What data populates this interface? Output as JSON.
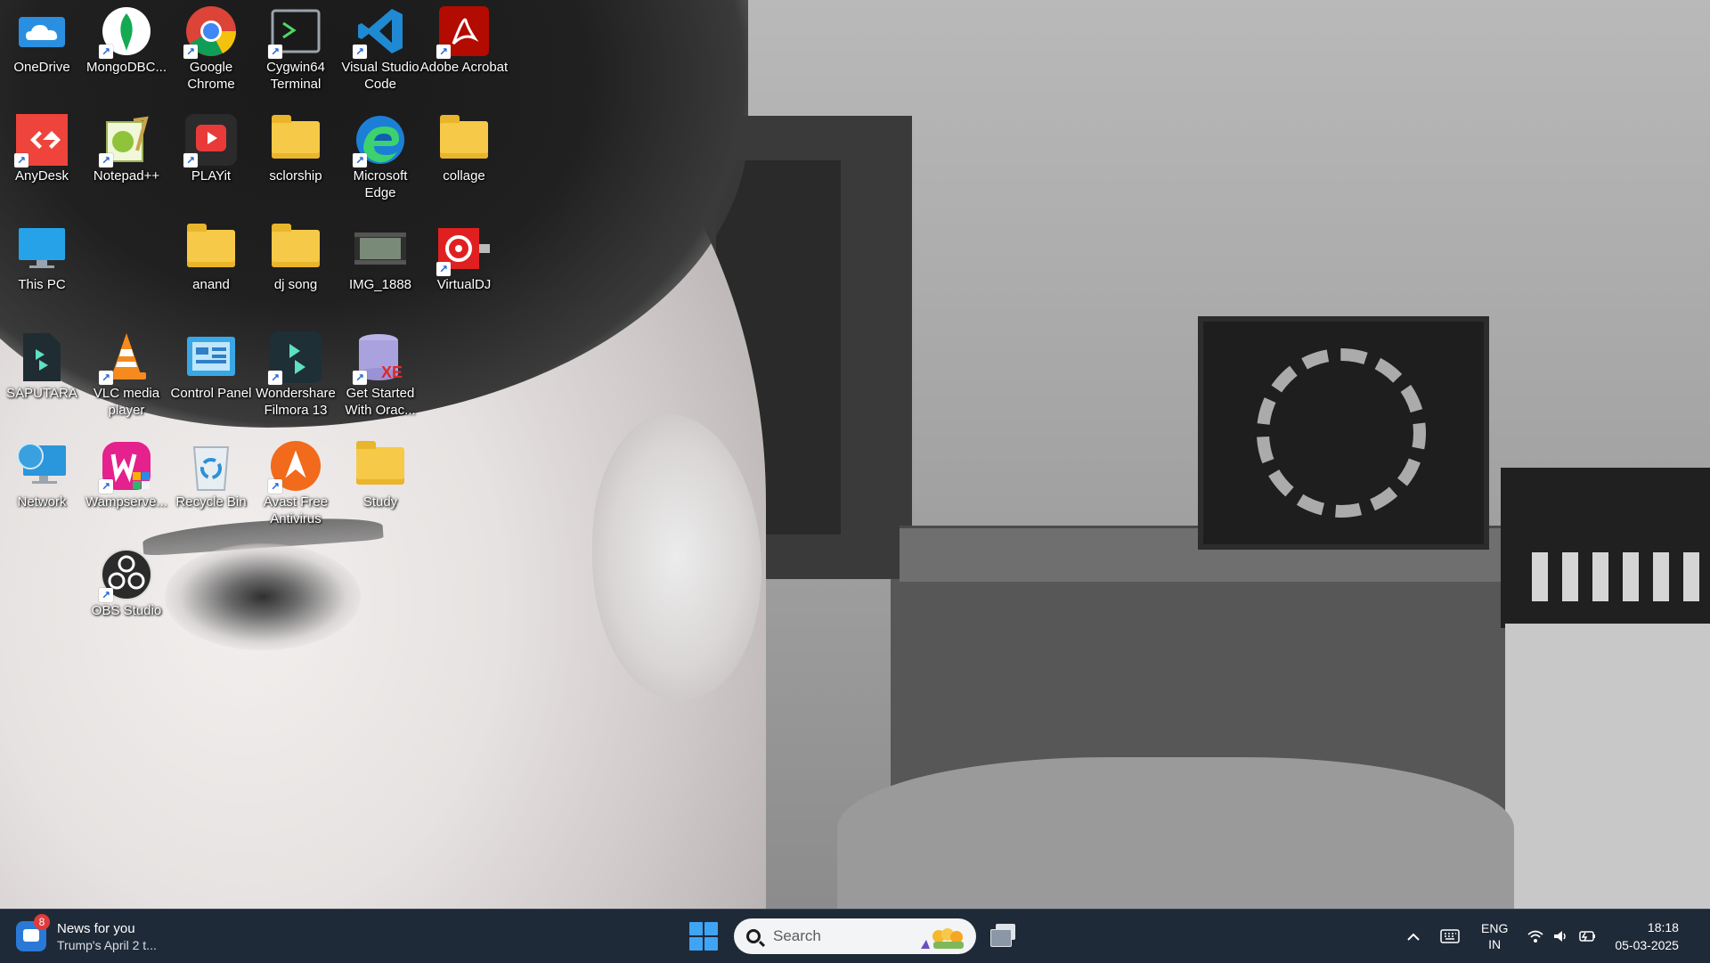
{
  "desktop": {
    "icons": [
      {
        "label": "OneDrive"
      },
      {
        "label": "MongoDBC..."
      },
      {
        "label": "Google Chrome"
      },
      {
        "label": "Cygwin64 Terminal"
      },
      {
        "label": "Visual Studio Code"
      },
      {
        "label": "Adobe Acrobat"
      },
      {
        "label": "AnyDesk"
      },
      {
        "label": "Notepad++"
      },
      {
        "label": "PLAYit"
      },
      {
        "label": "sclorship"
      },
      {
        "label": "Microsoft Edge"
      },
      {
        "label": "collage"
      },
      {
        "label": "This PC"
      },
      {
        "label": "anand"
      },
      {
        "label": "dj song"
      },
      {
        "label": "IMG_1888"
      },
      {
        "label": "VirtualDJ"
      },
      {
        "label": "SAPUTARA"
      },
      {
        "label": "VLC media player"
      },
      {
        "label": "Control Panel"
      },
      {
        "label": "Wondershare Filmora 13"
      },
      {
        "label": "Get Started With Orac..."
      },
      {
        "label": "Network"
      },
      {
        "label": "Wampserve..."
      },
      {
        "label": "Recycle Bin"
      },
      {
        "label": "Avast Free Antivirus"
      },
      {
        "label": "Study"
      },
      {
        "label": "OBS Studio"
      }
    ]
  },
  "taskbar": {
    "news": {
      "badge": "8",
      "title": "News for you",
      "subtitle": "Trump's April 2 t..."
    },
    "search": {
      "placeholder": "Search"
    },
    "tray": {
      "lang_top": "ENG",
      "lang_bottom": "IN",
      "time": "18:18",
      "date": "05-03-2025"
    },
    "icons": {
      "start": "windows-start-icon",
      "taskview": "task-view-icon",
      "chevron": "chevron-up-icon",
      "keyboard": "keyboard-icon",
      "wifi": "wifi-icon",
      "volume": "volume-icon",
      "battery": "battery-icon"
    }
  },
  "colors": {
    "taskbar_bg": "#1f2a38",
    "start_blue": "#3fa4f4",
    "folder_yellow": "#f7c948"
  }
}
